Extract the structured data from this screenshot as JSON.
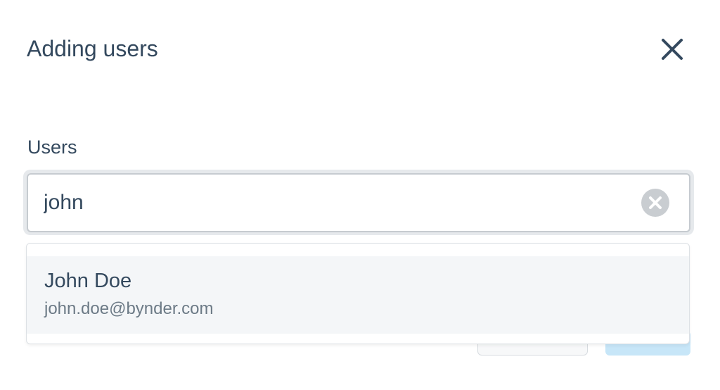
{
  "dialog": {
    "title": "Adding users"
  },
  "users_field": {
    "label": "Users",
    "value": "john",
    "placeholder": ""
  },
  "suggestions": [
    {
      "name": "John Doe",
      "email": "john.doe@bynder.com"
    }
  ],
  "icons": {
    "close": "close-icon",
    "clear": "clear-circle-icon"
  },
  "colors": {
    "text": "#34495e",
    "muted": "#6c7a86",
    "primary_disabled": "#c7e6f8",
    "highlight": "#f4f6f8"
  }
}
